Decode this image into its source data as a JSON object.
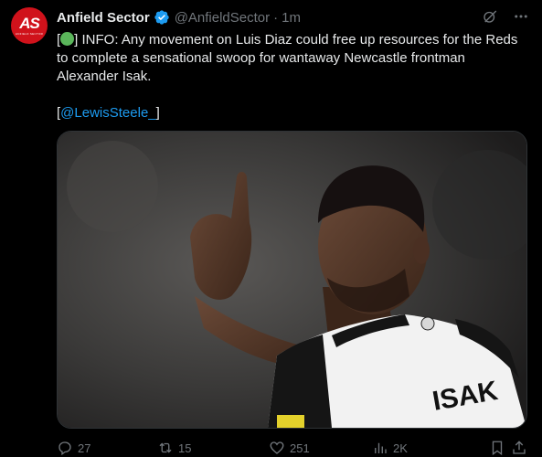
{
  "tweet": {
    "avatar_text": "AS",
    "avatar_subtext": "ANFIELD SECTOR",
    "author_name": "Anfield Sector",
    "handle": "@AnfieldSector",
    "separator": "·",
    "time": "1m",
    "text_prefix": "[",
    "text_main": "] INFO: Any movement on Luis Diaz could free up resources for the Reds to complete a sensational swoop for wantaway Newcastle frontman Alexander Isak.",
    "mention_open": "[",
    "mention": "@LewisSteele_",
    "mention_close": "]",
    "status_emoji_color": "#5bb65b",
    "image": {
      "description_icon": "footballer-photo",
      "shirt_text": "ISAK"
    }
  },
  "actions": {
    "replies": "27",
    "reposts": "15",
    "likes": "251",
    "views": "2K"
  },
  "colors": {
    "background": "#000000",
    "text": "#e7e9ea",
    "muted": "#71767b",
    "link": "#1d9bf0",
    "verified": "#1d9bf0",
    "avatar_bg": "#d0121b"
  }
}
